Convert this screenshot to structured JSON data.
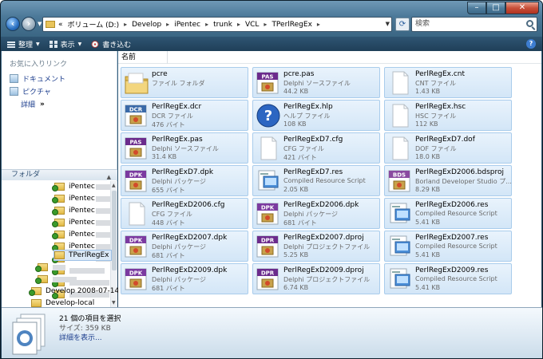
{
  "window": {
    "minimize_glyph": "–",
    "maximize_glyph": "□",
    "close_glyph": "✕"
  },
  "address": {
    "overflow": "«",
    "crumbs": [
      "ボリューム (D:)",
      "Develop",
      "iPentec",
      "trunk",
      "VCL",
      "TPerlRegEx"
    ],
    "separator": "▸"
  },
  "search": {
    "placeholder": "検索"
  },
  "toolbar": {
    "organize": "整理",
    "view": "表示",
    "burn": "書き込む"
  },
  "left_pane": {
    "favorites_title": "お気に入りリンク",
    "favorites": [
      "ドキュメント",
      "ピクチャ"
    ],
    "details": "詳細",
    "details_glyph": "»",
    "folders_title": "フォルダ",
    "tree": [
      {
        "label": "iPentec",
        "blurred": true
      },
      {
        "label": "iPentec",
        "blurred": true
      },
      {
        "label": "iPentec",
        "blurred": true
      },
      {
        "label": "iPentec",
        "blurred": true
      },
      {
        "label": "iPentec",
        "blurred": true
      },
      {
        "label": "iPentec",
        "blurred": true
      },
      {
        "label": "iPentec",
        "blurred": true
      },
      {
        "label": "",
        "blurred": true
      },
      {
        "label": "",
        "blurred": true
      },
      {
        "label": "",
        "blurred": true
      },
      {
        "label": "TPerlRegEx",
        "blurred": false,
        "selected": true
      },
      {
        "label": "",
        "blurred": true
      },
      {
        "label": "",
        "blurred": true
      },
      {
        "label": "Develop 2008-07-14",
        "blurred": false
      },
      {
        "label": "Develop-local",
        "blurred": false
      }
    ]
  },
  "main": {
    "column_name": "名前",
    "files": [
      {
        "name": "pcre",
        "type": "ファイル フォルダ",
        "size": "",
        "icon": "folder-icon"
      },
      {
        "name": "pcre.pas",
        "type": "Delphi ソースファイル",
        "size": "44.2 KB",
        "icon": "pas-file-icon",
        "badge": "PAS"
      },
      {
        "name": "PerlRegEx.cnt",
        "type": "CNT ファイル",
        "size": "1.43 KB",
        "icon": "blank-file-icon"
      },
      {
        "name": "PerlRegEx.dcr",
        "type": "DCR ファイル",
        "size": "476 バイト",
        "icon": "dcr-file-icon",
        "badge": "DCR"
      },
      {
        "name": "PerlRegEx.hlp",
        "type": "ヘルプ ファイル",
        "size": "108 KB",
        "icon": "help-file-icon"
      },
      {
        "name": "PerlRegEx.hsc",
        "type": "HSC ファイル",
        "size": "112 KB",
        "icon": "blank-file-icon"
      },
      {
        "name": "PerlRegEx.pas",
        "type": "Delphi ソースファイル",
        "size": "31.4 KB",
        "icon": "pas-file-icon",
        "badge": "PAS"
      },
      {
        "name": "PerlRegExD7.cfg",
        "type": "CFG ファイル",
        "size": "421 バイト",
        "icon": "blank-file-icon"
      },
      {
        "name": "PerlRegExD7.dof",
        "type": "DOF ファイル",
        "size": "18.0 KB",
        "icon": "blank-file-icon"
      },
      {
        "name": "PerlRegExD7.dpk",
        "type": "Delphi パッケージ",
        "size": "655 バイト",
        "icon": "dpk-file-icon",
        "badge": "DPK"
      },
      {
        "name": "PerlRegExD7.res",
        "type": "Compiled Resource Script",
        "size": "2.05 KB",
        "icon": "res-file-icon"
      },
      {
        "name": "PerlRegExD2006.bdsproj",
        "type": "Borland Developer Studio プ...",
        "size": "8.29 KB",
        "icon": "bds-file-icon",
        "badge": "BDS"
      },
      {
        "name": "PerlRegExD2006.cfg",
        "type": "CFG ファイル",
        "size": "448 バイト",
        "icon": "blank-file-icon"
      },
      {
        "name": "PerlRegExD2006.dpk",
        "type": "Delphi パッケージ",
        "size": "681 バイト",
        "icon": "dpk-file-icon",
        "badge": "DPK"
      },
      {
        "name": "PerlRegExD2006.res",
        "type": "Compiled Resource Script",
        "size": "5.41 KB",
        "icon": "res-file-icon"
      },
      {
        "name": "PerlRegExD2007.dpk",
        "type": "Delphi パッケージ",
        "size": "681 バイト",
        "icon": "dpk-file-icon",
        "badge": "DPK"
      },
      {
        "name": "PerlRegExD2007.dproj",
        "type": "Delphi プロジェクトファイル",
        "size": "5.25 KB",
        "icon": "dpr-file-icon",
        "badge": "DPR"
      },
      {
        "name": "PerlRegExD2007.res",
        "type": "Compiled Resource Script",
        "size": "5.41 KB",
        "icon": "res-file-icon"
      },
      {
        "name": "PerlRegExD2009.dpk",
        "type": "Delphi パッケージ",
        "size": "681 バイト",
        "icon": "dpk-file-icon",
        "badge": "DPK"
      },
      {
        "name": "PerlRegExD2009.dproj",
        "type": "Delphi プロジェクトファイル",
        "size": "6.74 KB",
        "icon": "dpr-file-icon",
        "badge": "DPR"
      },
      {
        "name": "PerlRegExD2009.res",
        "type": "Compiled Resource Script",
        "size": "5.41 KB",
        "icon": "res-file-icon"
      }
    ]
  },
  "status": {
    "count": "21 個の項目を選択",
    "size": "サイズ: 359 KB",
    "details_link": "詳細を表示..."
  }
}
